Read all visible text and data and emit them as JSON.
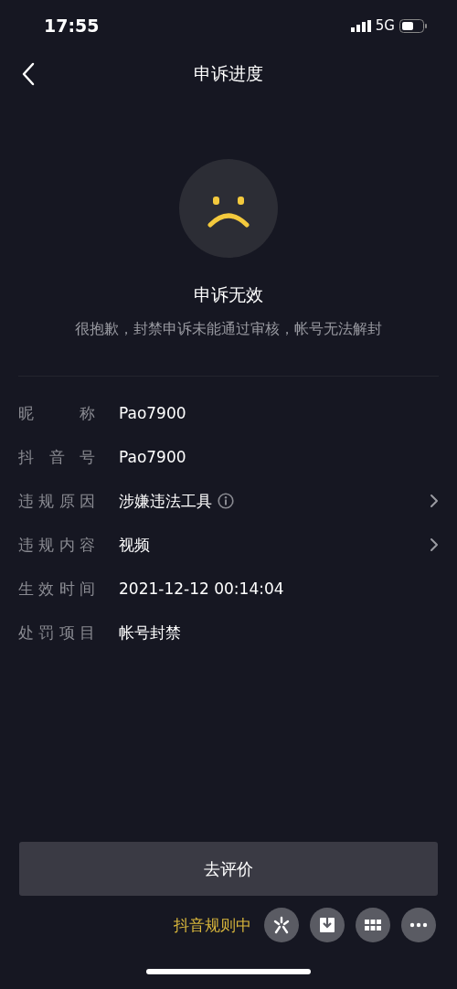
{
  "status_bar": {
    "time": "17:55",
    "network": "5G"
  },
  "nav": {
    "title": "申诉进度"
  },
  "result": {
    "title": "申诉无效",
    "message": "很抱歉，封禁申诉未能通过审核，帐号无法解封"
  },
  "details": [
    {
      "label": "昵称",
      "value": "Pao7900",
      "info": false,
      "has_link": false
    },
    {
      "label": "抖音号",
      "value": "Pao7900",
      "info": false,
      "has_link": false
    },
    {
      "label": "违规原因",
      "value": "涉嫌违法工具",
      "info": true,
      "has_link": true
    },
    {
      "label": "违规内容",
      "value": "视频",
      "info": false,
      "has_link": true
    },
    {
      "label": "生效时间",
      "value": "2021-12-12 00:14:04",
      "info": false,
      "has_link": false
    },
    {
      "label": "处罚项目",
      "value": "帐号封禁",
      "info": false,
      "has_link": false
    }
  ],
  "action_button": "去评价",
  "rules_link": "抖音规则中",
  "floating_actions": [
    {
      "kind": "spark"
    },
    {
      "kind": "download"
    },
    {
      "kind": "grid"
    },
    {
      "kind": "more"
    }
  ]
}
